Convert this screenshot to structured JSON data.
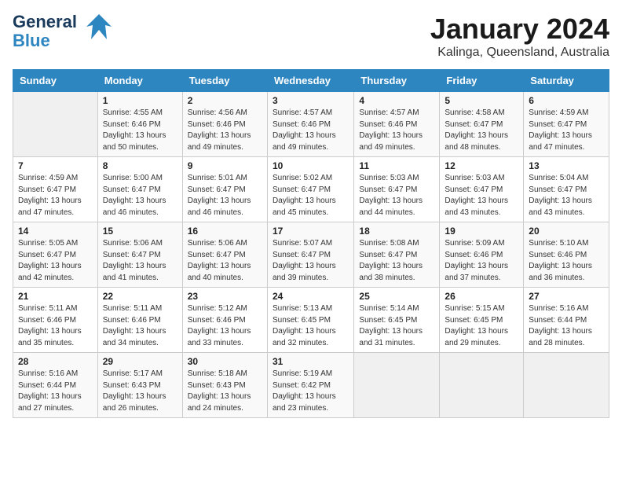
{
  "header": {
    "logo_line1": "General",
    "logo_line2": "Blue",
    "month_year": "January 2024",
    "location": "Kalinga, Queensland, Australia"
  },
  "days_of_week": [
    "Sunday",
    "Monday",
    "Tuesday",
    "Wednesday",
    "Thursday",
    "Friday",
    "Saturday"
  ],
  "weeks": [
    [
      {
        "day": "",
        "info": ""
      },
      {
        "day": "1",
        "info": "Sunrise: 4:55 AM\nSunset: 6:46 PM\nDaylight: 13 hours\nand 50 minutes."
      },
      {
        "day": "2",
        "info": "Sunrise: 4:56 AM\nSunset: 6:46 PM\nDaylight: 13 hours\nand 49 minutes."
      },
      {
        "day": "3",
        "info": "Sunrise: 4:57 AM\nSunset: 6:46 PM\nDaylight: 13 hours\nand 49 minutes."
      },
      {
        "day": "4",
        "info": "Sunrise: 4:57 AM\nSunset: 6:46 PM\nDaylight: 13 hours\nand 49 minutes."
      },
      {
        "day": "5",
        "info": "Sunrise: 4:58 AM\nSunset: 6:47 PM\nDaylight: 13 hours\nand 48 minutes."
      },
      {
        "day": "6",
        "info": "Sunrise: 4:59 AM\nSunset: 6:47 PM\nDaylight: 13 hours\nand 47 minutes."
      }
    ],
    [
      {
        "day": "7",
        "info": "Sunrise: 4:59 AM\nSunset: 6:47 PM\nDaylight: 13 hours\nand 47 minutes."
      },
      {
        "day": "8",
        "info": "Sunrise: 5:00 AM\nSunset: 6:47 PM\nDaylight: 13 hours\nand 46 minutes."
      },
      {
        "day": "9",
        "info": "Sunrise: 5:01 AM\nSunset: 6:47 PM\nDaylight: 13 hours\nand 46 minutes."
      },
      {
        "day": "10",
        "info": "Sunrise: 5:02 AM\nSunset: 6:47 PM\nDaylight: 13 hours\nand 45 minutes."
      },
      {
        "day": "11",
        "info": "Sunrise: 5:03 AM\nSunset: 6:47 PM\nDaylight: 13 hours\nand 44 minutes."
      },
      {
        "day": "12",
        "info": "Sunrise: 5:03 AM\nSunset: 6:47 PM\nDaylight: 13 hours\nand 43 minutes."
      },
      {
        "day": "13",
        "info": "Sunrise: 5:04 AM\nSunset: 6:47 PM\nDaylight: 13 hours\nand 43 minutes."
      }
    ],
    [
      {
        "day": "14",
        "info": "Sunrise: 5:05 AM\nSunset: 6:47 PM\nDaylight: 13 hours\nand 42 minutes."
      },
      {
        "day": "15",
        "info": "Sunrise: 5:06 AM\nSunset: 6:47 PM\nDaylight: 13 hours\nand 41 minutes."
      },
      {
        "day": "16",
        "info": "Sunrise: 5:06 AM\nSunset: 6:47 PM\nDaylight: 13 hours\nand 40 minutes."
      },
      {
        "day": "17",
        "info": "Sunrise: 5:07 AM\nSunset: 6:47 PM\nDaylight: 13 hours\nand 39 minutes."
      },
      {
        "day": "18",
        "info": "Sunrise: 5:08 AM\nSunset: 6:47 PM\nDaylight: 13 hours\nand 38 minutes."
      },
      {
        "day": "19",
        "info": "Sunrise: 5:09 AM\nSunset: 6:46 PM\nDaylight: 13 hours\nand 37 minutes."
      },
      {
        "day": "20",
        "info": "Sunrise: 5:10 AM\nSunset: 6:46 PM\nDaylight: 13 hours\nand 36 minutes."
      }
    ],
    [
      {
        "day": "21",
        "info": "Sunrise: 5:11 AM\nSunset: 6:46 PM\nDaylight: 13 hours\nand 35 minutes."
      },
      {
        "day": "22",
        "info": "Sunrise: 5:11 AM\nSunset: 6:46 PM\nDaylight: 13 hours\nand 34 minutes."
      },
      {
        "day": "23",
        "info": "Sunrise: 5:12 AM\nSunset: 6:46 PM\nDaylight: 13 hours\nand 33 minutes."
      },
      {
        "day": "24",
        "info": "Sunrise: 5:13 AM\nSunset: 6:45 PM\nDaylight: 13 hours\nand 32 minutes."
      },
      {
        "day": "25",
        "info": "Sunrise: 5:14 AM\nSunset: 6:45 PM\nDaylight: 13 hours\nand 31 minutes."
      },
      {
        "day": "26",
        "info": "Sunrise: 5:15 AM\nSunset: 6:45 PM\nDaylight: 13 hours\nand 29 minutes."
      },
      {
        "day": "27",
        "info": "Sunrise: 5:16 AM\nSunset: 6:44 PM\nDaylight: 13 hours\nand 28 minutes."
      }
    ],
    [
      {
        "day": "28",
        "info": "Sunrise: 5:16 AM\nSunset: 6:44 PM\nDaylight: 13 hours\nand 27 minutes."
      },
      {
        "day": "29",
        "info": "Sunrise: 5:17 AM\nSunset: 6:43 PM\nDaylight: 13 hours\nand 26 minutes."
      },
      {
        "day": "30",
        "info": "Sunrise: 5:18 AM\nSunset: 6:43 PM\nDaylight: 13 hours\nand 24 minutes."
      },
      {
        "day": "31",
        "info": "Sunrise: 5:19 AM\nSunset: 6:42 PM\nDaylight: 13 hours\nand 23 minutes."
      },
      {
        "day": "",
        "info": ""
      },
      {
        "day": "",
        "info": ""
      },
      {
        "day": "",
        "info": ""
      }
    ]
  ]
}
